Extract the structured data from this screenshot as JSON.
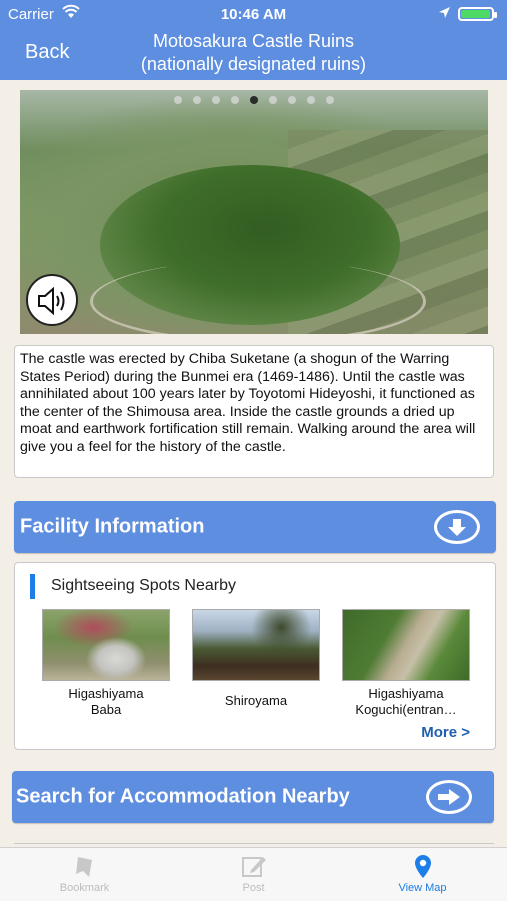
{
  "status_bar": {
    "carrier": "Carrier",
    "time": "10:46 AM",
    "battery_level": 0.95
  },
  "nav": {
    "back_label": "Back",
    "title_line1": "Motosakura Castle Ruins",
    "title_line2": "(nationally designated ruins)"
  },
  "gallery": {
    "page_count": 9,
    "active_index": 4
  },
  "description": "The castle was erected by Chiba Suketane (a shogun of the Warring States Period) during the Bunmei era (1469-1486). Until the castle was annihilated about 100 years later by Toyotomi Hideyoshi, it functioned as the center of the Shimousa area. Inside the castle grounds a dried up moat and earthwork fortification still remain. Walking around the area will give you a feel for the history of the castle.",
  "facility_button": {
    "label": "Facility Information",
    "icon": "down-arrow-circle-icon"
  },
  "nearby": {
    "header": "Sightseeing Spots Nearby",
    "spots": [
      {
        "name_line1": "Higashiyama",
        "name_line2": "Baba"
      },
      {
        "name_line1": "Shiroyama",
        "name_line2": ""
      },
      {
        "name_line1": "Higashiyama",
        "name_line2": "Koguchi(entran…"
      }
    ],
    "more_label": "More >"
  },
  "accommodation_button": {
    "label": "Search for Accommodation Nearby",
    "icon": "right-arrow-circle-icon"
  },
  "tabs": [
    {
      "label": "Bookmark",
      "icon": "bookmark-icon",
      "active": false
    },
    {
      "label": "Post",
      "icon": "post-icon",
      "active": false
    },
    {
      "label": "View Map",
      "icon": "map-pin-icon",
      "active": true
    }
  ],
  "colors": {
    "accent": "#5e8ee0",
    "tab_active": "#1d7ee8",
    "background": "#f3efe7"
  }
}
